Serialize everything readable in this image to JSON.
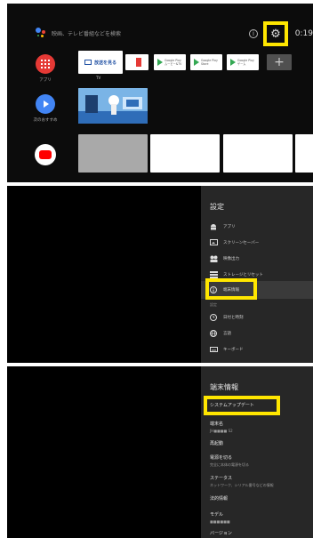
{
  "home": {
    "search_placeholder": "映画、テレビ番組などを検索",
    "clock": "0:19",
    "settings_icon": "gear-icon",
    "info_icon": "info-icon",
    "apps_label": "アプリ",
    "recommend_label": "次のおすすめ",
    "fav_tv_title": "放送を見る",
    "fav_tv_label": "TV",
    "playstore_tiles": [
      {
        "line1": "Google Play",
        "line2": "ムービー&TV"
      },
      {
        "line1": "Google Play",
        "line2": "Store"
      },
      {
        "line1": "Google Play",
        "line2": "ゲーム"
      }
    ],
    "add_tile": "+"
  },
  "settings_menu": {
    "title": "設定",
    "items": [
      {
        "label": "アプリ",
        "icon": "android-icon"
      },
      {
        "label": "スクリーンセーバー",
        "icon": "screensaver-icon"
      },
      {
        "label": "映像出力",
        "icon": "video-output-icon"
      },
      {
        "label": "ストレージとリセット",
        "icon": "storage-icon"
      },
      {
        "label": "端末情報",
        "icon": "info-icon"
      }
    ],
    "section_label": "設定",
    "items2": [
      {
        "label": "日付と時刻",
        "icon": "clock-icon"
      },
      {
        "label": "言語",
        "icon": "globe-icon"
      },
      {
        "label": "キーボード",
        "icon": "keyboard-icon"
      }
    ]
  },
  "device_info": {
    "title": "端末情報",
    "system_update": "システムアップデート",
    "device_name_label": "端末名",
    "device_name_value": "JH■■■■ S2",
    "restart": "再起動",
    "power_off_title": "電源を切る",
    "power_off_sub": "完全に本体の電源を切る",
    "status_title": "ステータス",
    "status_sub": "ネットワーク、シリアル番号などの情報",
    "legal": "法的情報",
    "model_title": "モデル",
    "model_value": "■■■■■■",
    "version_title": "バージョン"
  },
  "colors": {
    "highlight": "#ffe600",
    "apps_red": "#e53935",
    "play_blue": "#4285f4",
    "youtube_red": "#ff0000"
  }
}
